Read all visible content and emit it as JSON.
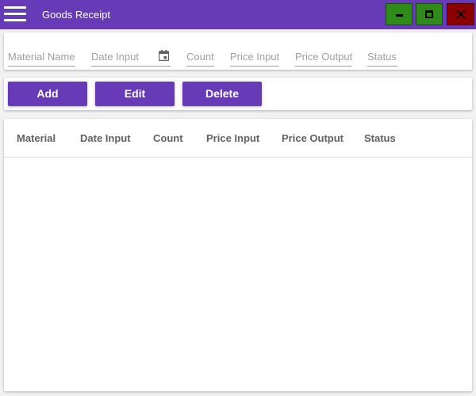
{
  "window": {
    "title": "Goods Receipt",
    "accent_color": "#673ab7",
    "controls": {
      "minimize_icon": "minimize-icon",
      "maximize_icon": "maximize-icon",
      "close_icon": "close-icon",
      "min_max_color": "#2e8b19",
      "close_color": "#8b0000"
    }
  },
  "form": {
    "material_name": {
      "placeholder": "Material Name",
      "value": ""
    },
    "date_input": {
      "placeholder": "Date Input",
      "value": "",
      "icon": "calendar-icon"
    },
    "count": {
      "placeholder": "Count",
      "value": ""
    },
    "price_input": {
      "placeholder": "Price Input",
      "value": ""
    },
    "price_output": {
      "placeholder": "Price Output",
      "value": ""
    },
    "status": {
      "placeholder": "Status",
      "value": ""
    }
  },
  "actions": {
    "add_label": "Add",
    "edit_label": "Edit",
    "delete_label": "Delete"
  },
  "table": {
    "columns": [
      "Material",
      "Date Input",
      "Count",
      "Price Input",
      "Price Output",
      "Status"
    ],
    "rows": []
  }
}
